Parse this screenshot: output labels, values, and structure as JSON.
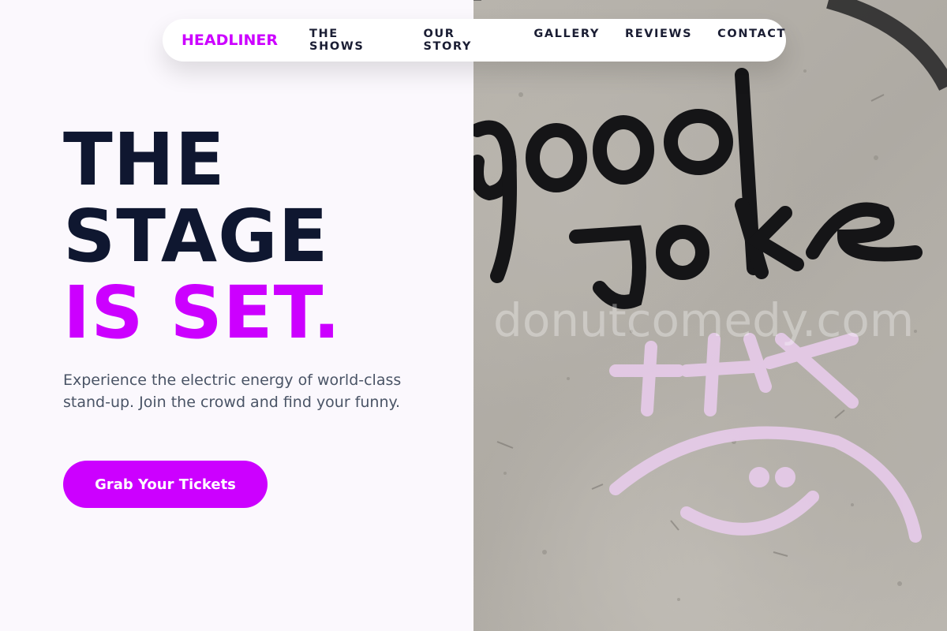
{
  "nav": {
    "brand": "HEADLINER",
    "items": [
      "THE SHOWS",
      "OUR STORY",
      "GALLERY",
      "REVIEWS",
      "CONTACT"
    ]
  },
  "hero": {
    "headline_lines": [
      "THE",
      "STAGE"
    ],
    "headline_accent": "IS SET.",
    "subtitle": "Experience the electric energy of world-class stand-up. Join the crowd and find your funny.",
    "cta_label": "Grab Your Tickets"
  },
  "photo": {
    "graffiti_text": "good joke",
    "tag_text": "+IX",
    "watermark": "donutcomedy.com"
  },
  "colors": {
    "accent": "#cc00ff",
    "heading": "#0f1730",
    "body_text": "#4a5466",
    "page_background": "#fbf8fd"
  }
}
